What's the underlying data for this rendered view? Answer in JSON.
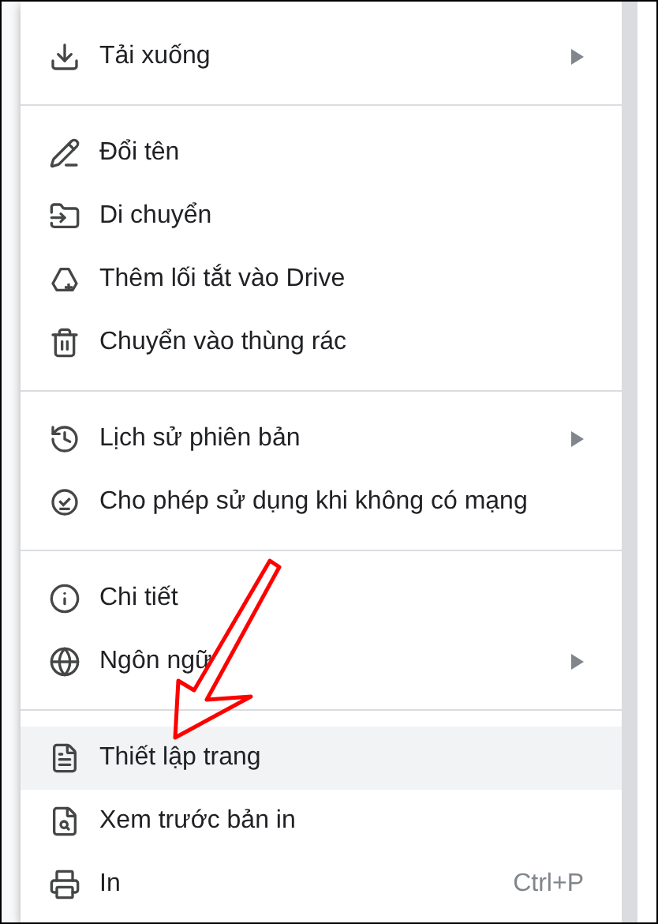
{
  "menu": {
    "groups": [
      {
        "items": [
          {
            "label": "Tải xuống",
            "submenu": true,
            "selected": false
          }
        ]
      },
      {
        "items": [
          {
            "label": "Đổi tên",
            "submenu": false,
            "selected": false
          },
          {
            "label": "Di chuyển",
            "submenu": false,
            "selected": false
          },
          {
            "label": "Thêm lối tắt vào Drive",
            "submenu": false,
            "selected": false
          },
          {
            "label": "Chuyển vào thùng rác",
            "submenu": false,
            "selected": false
          }
        ]
      },
      {
        "items": [
          {
            "label": "Lịch sử phiên bản",
            "submenu": true,
            "selected": false
          },
          {
            "label": "Cho phép sử dụng khi không có mạng",
            "submenu": false,
            "selected": false
          }
        ]
      },
      {
        "items": [
          {
            "label": "Chi tiết",
            "submenu": false,
            "selected": false
          },
          {
            "label": "Ngôn ngữ",
            "submenu": true,
            "selected": false
          }
        ]
      },
      {
        "items": [
          {
            "label": "Thiết lập trang",
            "submenu": false,
            "selected": true
          },
          {
            "label": "Xem trước bản in",
            "submenu": false,
            "selected": false
          },
          {
            "label": "In",
            "submenu": false,
            "selected": false,
            "shortcut": "Ctrl+P"
          }
        ]
      }
    ]
  }
}
